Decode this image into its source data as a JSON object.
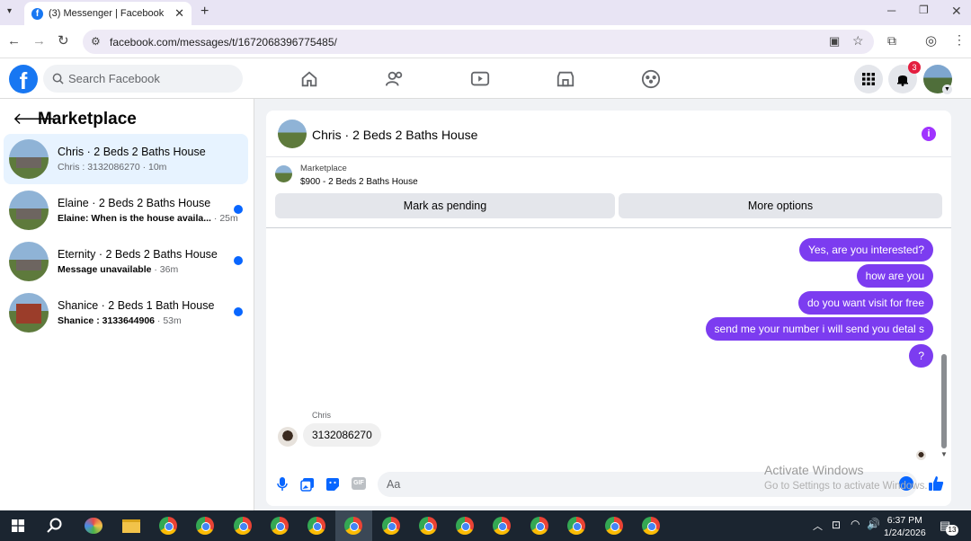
{
  "browser": {
    "tab_title": "(3) Messenger | Facebook",
    "url": "facebook.com/messages/t/1672068396775485/"
  },
  "header": {
    "search_placeholder": "Search Facebook",
    "notification_count": "3"
  },
  "sidebar": {
    "title": "Marketplace",
    "conversations": [
      {
        "name": "Chris · 2 Beds 2 Baths House",
        "sender": "Chris",
        "preview": " : 3132086270",
        "time": " · 10m"
      },
      {
        "name": "Elaine · 2 Beds 2 Baths House",
        "sender": "Elaine",
        "preview": ": When is the house availa...",
        "time": " · 25m"
      },
      {
        "name": "Eternity · 2 Beds 2 Baths House",
        "sender": "",
        "preview": "Message unavailable",
        "time": " · 36m"
      },
      {
        "name": "Shanice · 2 Beds 1 Bath House",
        "sender": "Shanice",
        "preview": " : 3133644906",
        "time": " · 53m"
      }
    ]
  },
  "chat": {
    "title": "Chris · 2 Beds 2 Baths House",
    "listing_category": "Marketplace",
    "listing_price": "$900 - 2 Beds 2 Baths House",
    "mark_pending": "Mark as pending",
    "more_options": "More options",
    "messages_out": [
      "Yes, are you interested?",
      "how are you",
      "do you want visit for free",
      "send me your number i will send you detal s",
      "?"
    ],
    "incoming_sender": "Chris",
    "incoming_message": "3132086270",
    "composer_placeholder": "Aa"
  },
  "watermark": {
    "line1": "Activate Windows",
    "line2": "Go to Settings to activate Windows."
  },
  "taskbar": {
    "time": "6:37 PM",
    "date": "1/24/2026",
    "notif_count": "13"
  }
}
